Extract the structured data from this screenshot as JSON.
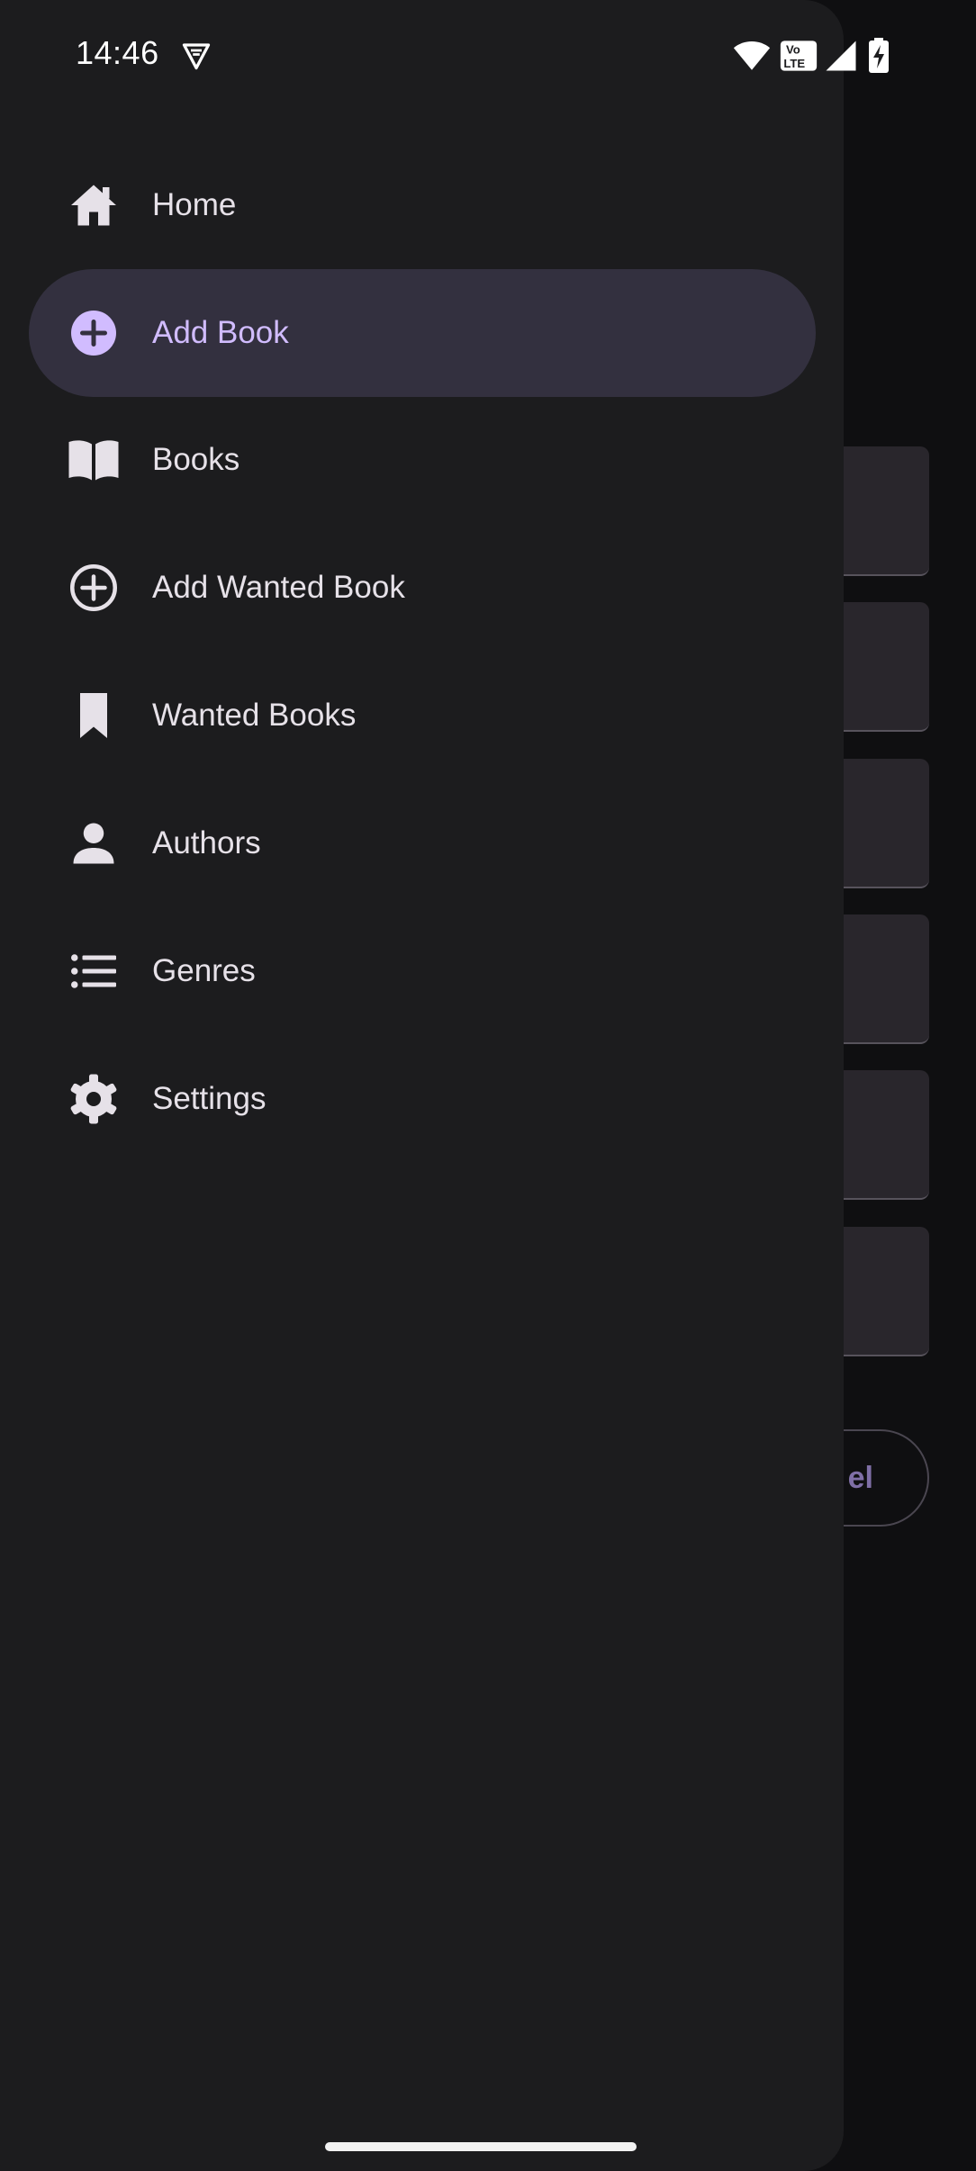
{
  "status_bar": {
    "time": "14:46"
  },
  "nav": {
    "items": [
      {
        "label": "Home",
        "icon": "home-icon",
        "active": false
      },
      {
        "label": "Add Book",
        "icon": "add-circle-filled-icon",
        "active": true
      },
      {
        "label": "Books",
        "icon": "open-book-icon",
        "active": false
      },
      {
        "label": "Add Wanted Book",
        "icon": "add-circle-outline-icon",
        "active": false
      },
      {
        "label": "Wanted Books",
        "icon": "bookmark-icon",
        "active": false
      },
      {
        "label": "Authors",
        "icon": "person-icon",
        "active": false
      },
      {
        "label": "Genres",
        "icon": "list-icon",
        "active": false
      },
      {
        "label": "Settings",
        "icon": "gear-icon",
        "active": false
      }
    ]
  },
  "background": {
    "cancel_label_partial": "el"
  },
  "colors": {
    "drawer_bg": "#1c1c1e",
    "active_item_bg": "#33303f",
    "accent": "#d1bcff",
    "text": "#e6e1e8",
    "screen_bg": "#0f0f11"
  }
}
